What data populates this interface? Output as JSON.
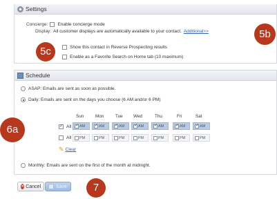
{
  "settings": {
    "title": "Settings",
    "concierge_label": "Concierge:",
    "concierge_option": "Enable concierge mode",
    "display_label": "Display:",
    "display_text": "All customer displays are automatically available to your contact.",
    "additional_link": "Additional>>",
    "reverse_prospecting": "Show this contact in Reverse Prospecting results",
    "favorite_search": "Enable as a Favorite Search on Home tab (10 maximum)"
  },
  "schedule": {
    "title": "Schedule",
    "asap_option": "ASAP: Emails are sent as soon as possible.",
    "daily_option": "Daily: Emails are sent on the days you choose (6 AM and/or 6 PM)",
    "days": [
      "Sun",
      "Mon",
      "Tue",
      "Wed",
      "Thu",
      "Fri",
      "Sat"
    ],
    "all_am_label": "All AM",
    "all_pm_label": "All PM",
    "am_label": "AM",
    "pm_label": "PM",
    "clear_link": "Clear",
    "monthly_option": "Monthly: Emails are sent on the first of the month at midnight."
  },
  "buttons": {
    "cancel_label": "Cancel",
    "save_label": "Save"
  },
  "callouts": {
    "b5": "5b",
    "c5": "5c",
    "a6": "6a",
    "n7": "7"
  },
  "colors": {
    "callout": "#b8381d",
    "link": "#2f63b7",
    "am_cell": "#b7cbe6"
  }
}
